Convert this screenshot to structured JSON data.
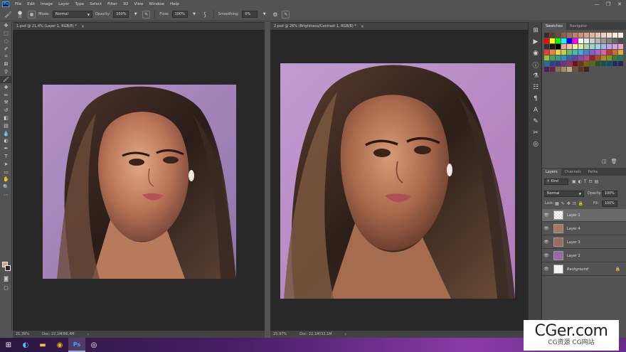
{
  "app": {
    "logo": "Ps"
  },
  "menu": [
    "File",
    "Edit",
    "Image",
    "Layer",
    "Type",
    "Select",
    "Filter",
    "3D",
    "View",
    "Window",
    "Help"
  ],
  "window_controls": {
    "minimize": "—",
    "restore": "❐",
    "close": "✕"
  },
  "options": {
    "brush_size": "25",
    "mode_label": "Mode:",
    "mode_value": "Normal",
    "opacity_label": "Opacity:",
    "opacity_value": "100%",
    "flow_label": "Flow:",
    "flow_value": "100%",
    "smoothing_label": "Smoothing:",
    "smoothing_value": "0%"
  },
  "documents": [
    {
      "tab": "1.psd @ 21,4% (Layer 1, RGB/8) *",
      "close": "×",
      "zoom": "21,39%",
      "doc_info": "Doc: 22,1M/86,4M",
      "status_arrow": "›"
    },
    {
      "tab": "2.psd @ 26% (Brightness/Contrast 1, RGB/8) *",
      "close": "×",
      "zoom": "25,97%",
      "doc_info": "Doc: 22,1M/32,1M",
      "status_arrow": "›"
    }
  ],
  "swatches_panel": {
    "tabs": [
      "Swatches",
      "Navigator"
    ],
    "colors": [
      "#3b2a2a",
      "#5a3e36",
      "#6e4b3f",
      "#8a5f4e",
      "#a2715c",
      "#b98469",
      "#c99379",
      "#d6a38a",
      "#dfb49c",
      "#e8c4ad",
      "#eed2bd",
      "#f2ddcb",
      "#f6e7da",
      "#faf1e8",
      "#ff0000",
      "#ffff00",
      "#00ff00",
      "#00ffff",
      "#0000ff",
      "#ff00ff",
      "#ffffff",
      "#e6e6e6",
      "#cccccc",
      "#b3b3b3",
      "#999999",
      "#808080",
      "#666666",
      "#4d4d4d",
      "#333333",
      "#1a1a1a",
      "#000000",
      "#f5a0a0",
      "#f7c39a",
      "#fde69b",
      "#d7ec9c",
      "#a6dba0",
      "#9cd6c7",
      "#9ed3ea",
      "#a2b8e6",
      "#b7a5e0",
      "#d6a3df",
      "#efa4c8",
      "#e83c3c",
      "#ef7f3a",
      "#f8cf3c",
      "#b6d83e",
      "#5fbf5f",
      "#3ebfa8",
      "#3eb0e0",
      "#4d7fd6",
      "#7a5fd0",
      "#b35fd0",
      "#e05fa6",
      "#c83232",
      "#d2692e",
      "#d9b22e",
      "#9cbf33",
      "#4aa34a",
      "#2e9e89",
      "#2e8fbf",
      "#3a62b3",
      "#5e45ad",
      "#9445ad",
      "#bf4588",
      "#9e1f1f",
      "#a6501f",
      "#ad8b1f",
      "#7a9a22",
      "#337f33",
      "#1f7a6a",
      "#1f6f99",
      "#26478f",
      "#43308a",
      "#73308a",
      "#992f6a",
      "#6e1414",
      "#733612",
      "#7a6012",
      "#556b15",
      "#225922",
      "#135448",
      "#134b6b",
      "#182f63",
      "#2c1f5e",
      "#4e1f5e",
      "#6b1f49",
      "#8c6b4a",
      "#a98a64",
      "#c4a880",
      "#6f5238",
      "#523a26",
      "#392717"
    ],
    "footer_icons": {
      "new": "◫",
      "trash": "🗑"
    }
  },
  "layers_panel": {
    "tabs": [
      "Layers",
      "Channels",
      "Paths"
    ],
    "filter_kind": "Kind",
    "blend_mode": "Normal",
    "opacity_label": "Opacity:",
    "opacity_value": "100%",
    "lock_label": "Lock:",
    "fill_label": "Fill:",
    "fill_value": "100%",
    "layers": [
      {
        "name": "Layer 1",
        "selected": true,
        "italic": false,
        "color": "#cfcfcf"
      },
      {
        "name": "Layer 4",
        "selected": false,
        "italic": false,
        "color": "#a27a66"
      },
      {
        "name": "Layer 3",
        "selected": false,
        "italic": false,
        "color": "#9b6d5c"
      },
      {
        "name": "Layer 2",
        "selected": false,
        "italic": false,
        "color": "#9a67a8"
      },
      {
        "name": "Background",
        "selected": false,
        "italic": true,
        "color": "#f2f2f2",
        "lock": "🔒"
      }
    ]
  },
  "watermark": {
    "main": "CGer.com",
    "sub": "CG资源 CG网站"
  }
}
